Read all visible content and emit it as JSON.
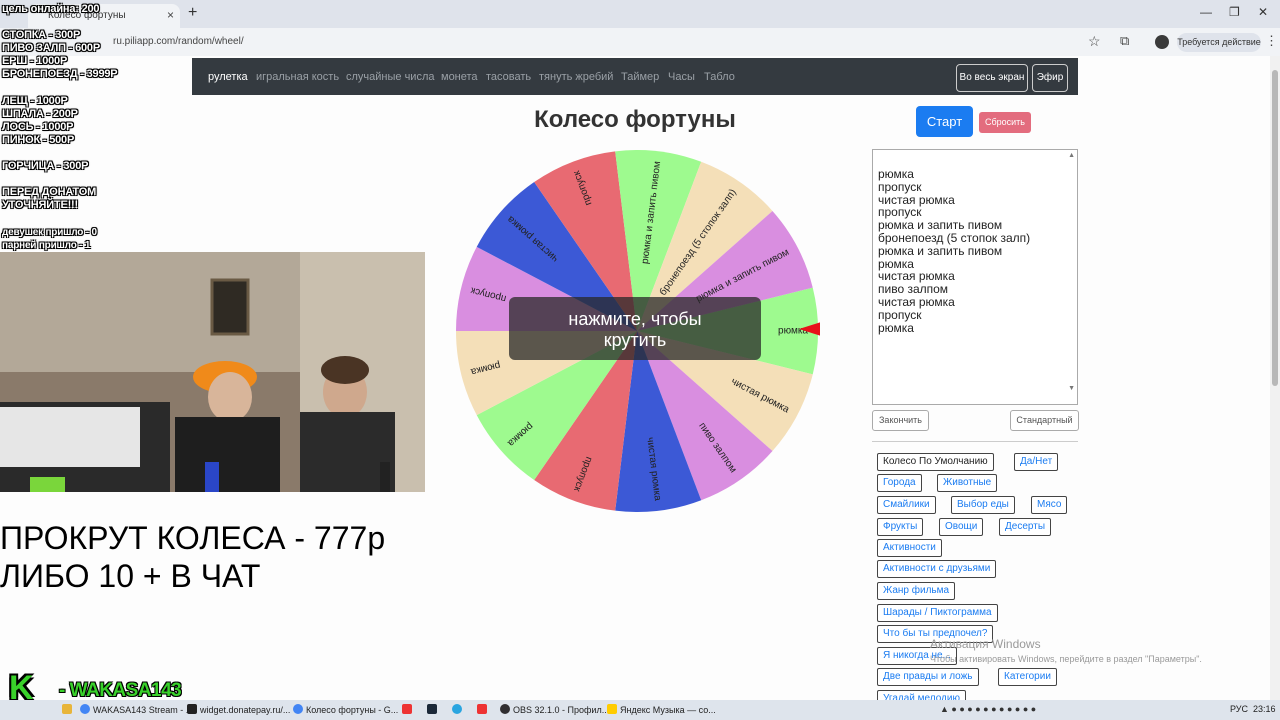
{
  "browser": {
    "tab_title": "Колесо фортуны",
    "url": "ru.piliapp.com/random/wheel/",
    "action_label": "Требуется действие"
  },
  "nav": {
    "links": [
      "рулетка",
      "игральная кость",
      "случайные числа",
      "монета",
      "тасовать",
      "тянуть жребий",
      "Таймер",
      "Часы",
      "Табло"
    ],
    "fullscreen_label": "Во весь экран",
    "live_label": "Эфир"
  },
  "wheel": {
    "title": "Колесо фортуны",
    "start_label": "Старт",
    "reset_label": "Сбросить",
    "overlay_line1": "нажмите, чтобы",
    "overlay_line2": "крутить",
    "colors": [
      "#9efa8f",
      "#f4dfb8",
      "#d98ee0",
      "#3c59d6",
      "#e86a72"
    ],
    "segments": [
      "рюмка",
      "чистая рюмка",
      "пиво залпом",
      "чистая рюмка",
      "пропуск",
      "рюмка",
      "рюмка",
      "пропуск",
      "чистая рюмка",
      "пропуск",
      "рюмка и запить пивом",
      "бронепоезд (5 стопок залп)",
      "рюмка и запить пивом"
    ],
    "pointer_color": "#e8101a"
  },
  "entries": {
    "items": [
      "рюмка",
      "пропуск",
      "чистая рюмка",
      "пропуск",
      "рюмка и запить пивом",
      "бронепоезд (5 стопок залп)",
      "рюмка и запить пивом",
      "рюмка",
      "чистая рюмка",
      "пиво залпом",
      "чистая рюмка",
      "пропуск",
      "рюмка"
    ],
    "finish_label": "Закончить",
    "standard_label": "Стандартный"
  },
  "presets": [
    "Колесо По Умолчанию",
    "Да/Нет",
    "Города",
    "Животные",
    "Смайлики",
    "Выбор еды",
    "Мясо",
    "Фрукты",
    "Овощи",
    "Десерты",
    "Активности",
    "Активности с друзьями",
    "Жанр фильма",
    "Шарады / Пиктограмма",
    "Что бы ты предпочел?",
    "Я никогда не...",
    "Две правды и ложь",
    "Категории",
    "Угадай мелодию"
  ],
  "windows_activation": {
    "line1": "Активация Windows",
    "line2": "Чтобы активировать Windows, перейдите в раздел \"Параметры\"."
  },
  "stream_overlay": {
    "goal": "цель онлайна: 200",
    "prices": [
      "СТОПКА - 300Р",
      "ПИВО ЗАЛП - 600Р",
      "ЕРШ - 1000Р",
      "БРОНЕПОЕЗД - 3999Р"
    ],
    "prices2": [
      "ЛЕЩ - 1000Р",
      "ШПАЛА - 200Р",
      "ЛОСЬ - 1000Р",
      "ПИНОК - 500Р"
    ],
    "mustard": "ГОРЧИЦА - 300Р",
    "note1": "ПЕРЕД ДОНАТОМ",
    "note2": "УТОЧНЯЙТЕ!!!",
    "girls": "девушек пришло - 0",
    "guys": "парней пришло - 1",
    "spin_line1": "ПРОКРУТ КОЛЕСА - 777р",
    "spin_line2": "ЛИБО 10 + В ЧАТ",
    "brand_k": "K",
    "brand_name": "- WAKASA143"
  },
  "taskbar": {
    "items": [
      "WAKASA143 Stream - ...",
      "widget.donatepay.ru/...",
      "Колесо фортуны - G...",
      "OBS 32.1.0 - Профил...",
      "Яндекс Музыка — со..."
    ],
    "lang": "РУС",
    "time": "23:16"
  }
}
